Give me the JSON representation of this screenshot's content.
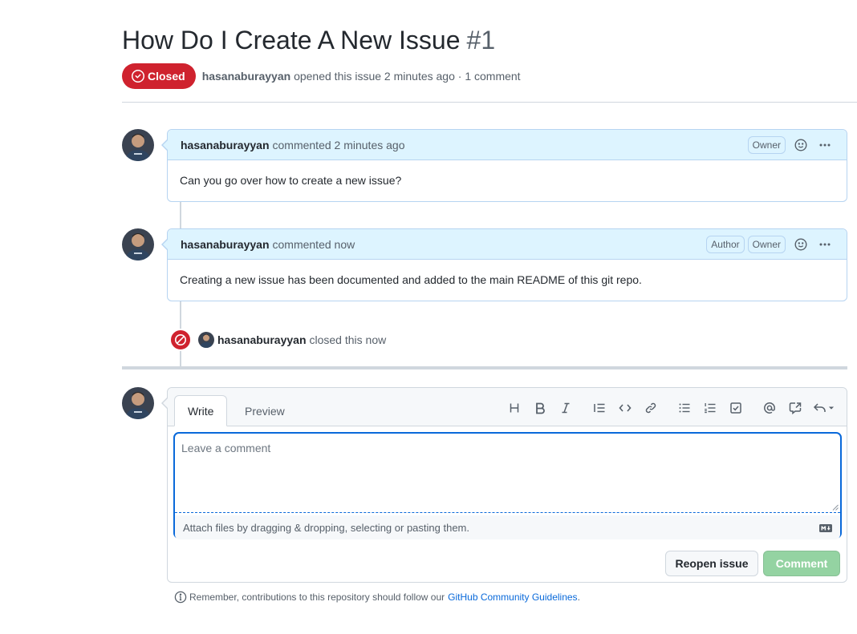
{
  "issue": {
    "title": "How Do I Create A New Issue",
    "number": "#1",
    "state_label": "Closed",
    "author": "hasanaburayyan",
    "meta_text": "opened this issue 2 minutes ago · 1 comment"
  },
  "comments": [
    {
      "author": "hasanaburayyan",
      "action": "commented 2 minutes ago",
      "labels": [
        "Owner"
      ],
      "body": "Can you go over how to create a new issue?"
    },
    {
      "author": "hasanaburayyan",
      "action": "commented now",
      "labels": [
        "Author",
        "Owner"
      ],
      "body": "Creating a new issue has been documented and added to the main README of this git repo."
    }
  ],
  "event": {
    "author": "hasanaburayyan",
    "text": "closed this now"
  },
  "editor": {
    "tabs": [
      "Write",
      "Preview"
    ],
    "placeholder": "Leave a comment",
    "attach_text": "Attach files by dragging & dropping, selecting or pasting them.",
    "toolbar": [
      "heading-icon",
      "bold-icon",
      "italic-icon",
      "quote-icon",
      "code-icon",
      "link-icon",
      "bullet-list-icon",
      "numbered-list-icon",
      "task-list-icon",
      "mention-icon",
      "cross-reference-icon",
      "reply-icon"
    ],
    "reopen_label": "Reopen issue",
    "comment_label": "Comment"
  },
  "footer": {
    "note": "Remember, contributions to this repository should follow our",
    "link": "GitHub Community Guidelines",
    "suffix": "."
  },
  "colors": {
    "closed_red": "#cf222e",
    "comment_header_bg": "#ddf4ff",
    "link_blue": "#0969da",
    "comment_button_disabled": "#94d3a2"
  }
}
